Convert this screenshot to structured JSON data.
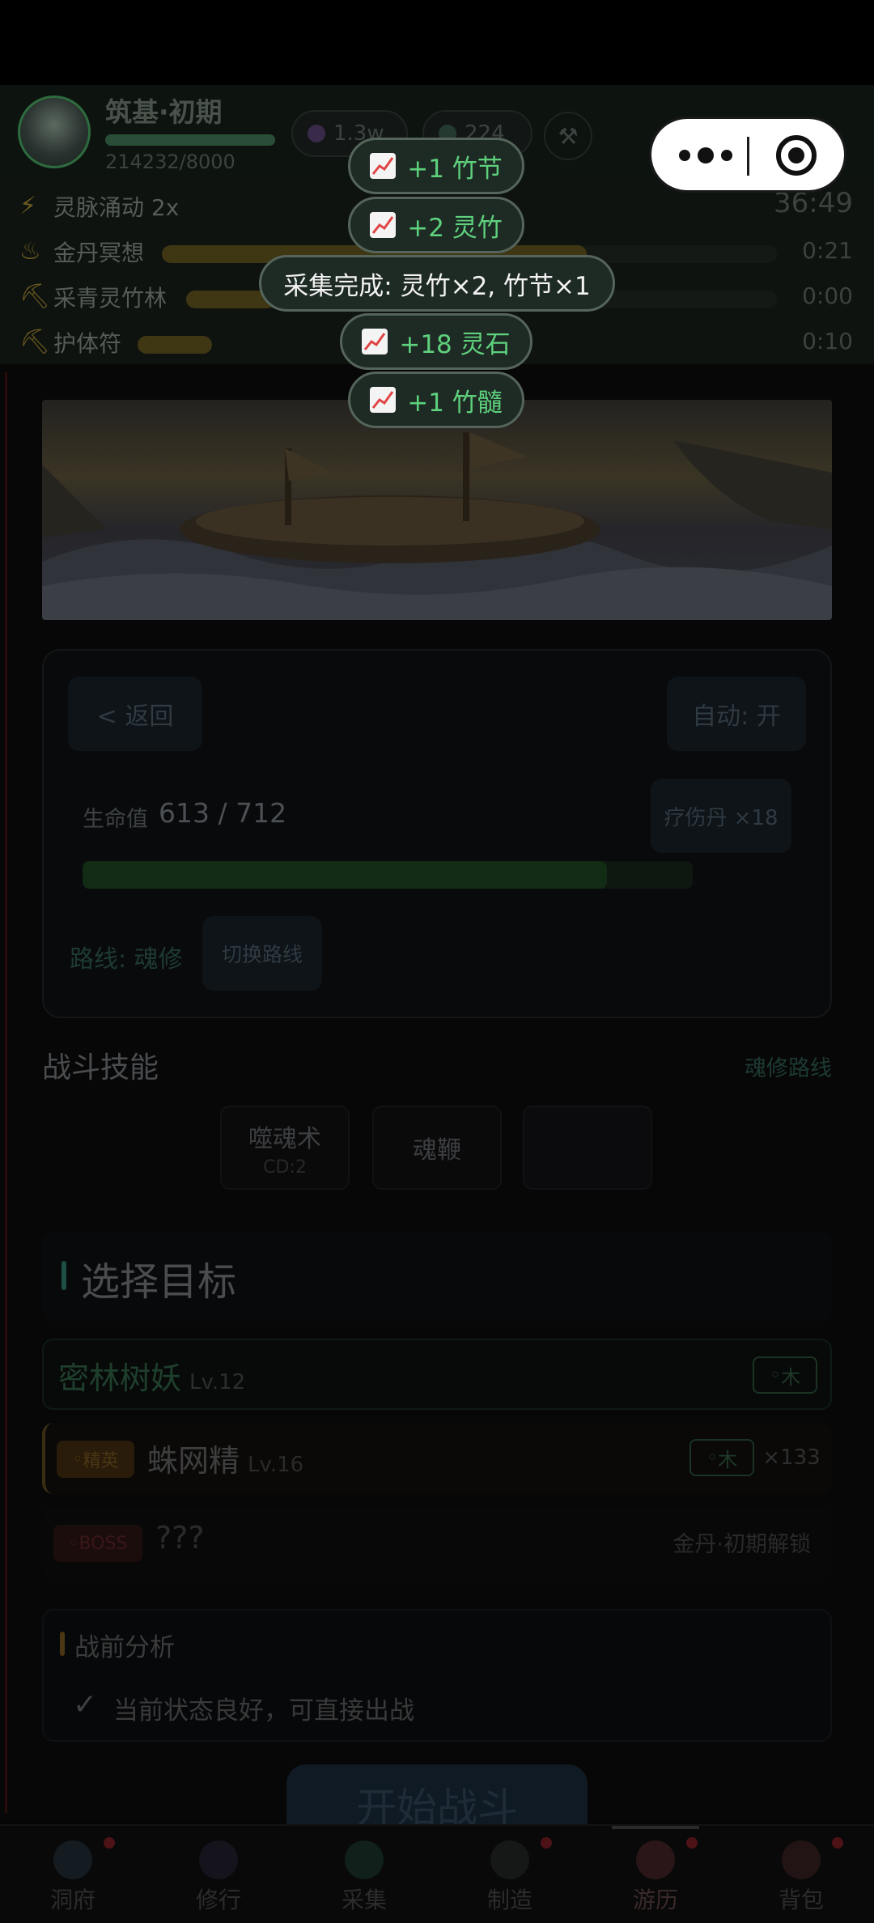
{
  "header": {
    "realm": "筑基·初期",
    "exp_text": "214232/8000",
    "resource1": "1.3w",
    "resource2": "224"
  },
  "buffs": [
    {
      "icon": "lightning-icon",
      "name": "灵脉涌动 2x",
      "time": "36:49",
      "progress": 0
    },
    {
      "icon": "meditation-icon",
      "name": "金丹冥想",
      "time": "0:21",
      "progress": 0.72
    },
    {
      "icon": "pickaxe-icon",
      "name": "采青灵竹林",
      "time": "0:00",
      "progress": 0.15
    },
    {
      "icon": "pickaxe-icon",
      "name": "护体符",
      "time": "0:10",
      "progress": 0.95
    }
  ],
  "battle": {
    "back": "< 返回",
    "auto": "自动: 开",
    "hp_label": "生命值",
    "hp_value": "613 / 712",
    "hp_ratio": 0.86,
    "potion": "疗伤丹 ×18",
    "route_label": "路线: 魂修",
    "switch_route": "切换路线"
  },
  "skills": {
    "title": "战斗技能",
    "link": "魂修路线",
    "items": [
      {
        "name": "噬魂术",
        "sub": "CD:2"
      },
      {
        "name": "魂鞭",
        "sub": ""
      },
      {
        "name": "",
        "sub": ""
      }
    ]
  },
  "targets": {
    "title": "选择目标",
    "list": [
      {
        "name": "密林树妖",
        "level": "Lv.12",
        "badge": "",
        "element": "木",
        "count": ""
      },
      {
        "name": "蛛网精",
        "level": "Lv.16",
        "badge": "精英",
        "element": "木",
        "count": "×133"
      },
      {
        "name": "???",
        "level": "",
        "badge": "BOSS",
        "element": "",
        "count": "",
        "lock": "金丹·初期解锁"
      }
    ]
  },
  "analysis": {
    "title": "战前分析",
    "text": "当前状态良好，可直接出战"
  },
  "start_button": "开始战斗",
  "tabs": [
    {
      "label": "洞府",
      "dot": true
    },
    {
      "label": "修行",
      "dot": false
    },
    {
      "label": "采集",
      "dot": false
    },
    {
      "label": "制造",
      "dot": true
    },
    {
      "label": "游历",
      "dot": true,
      "active": true
    },
    {
      "label": "背包",
      "dot": true
    }
  ],
  "toasts": [
    {
      "text": "+1 竹节",
      "icon": true
    },
    {
      "text": "+2 灵竹",
      "icon": true
    },
    {
      "text": "采集完成: 灵竹×2, 竹节×1",
      "icon": false
    },
    {
      "text": "+18 灵石",
      "icon": true
    },
    {
      "text": "+1 竹髓",
      "icon": true
    }
  ]
}
